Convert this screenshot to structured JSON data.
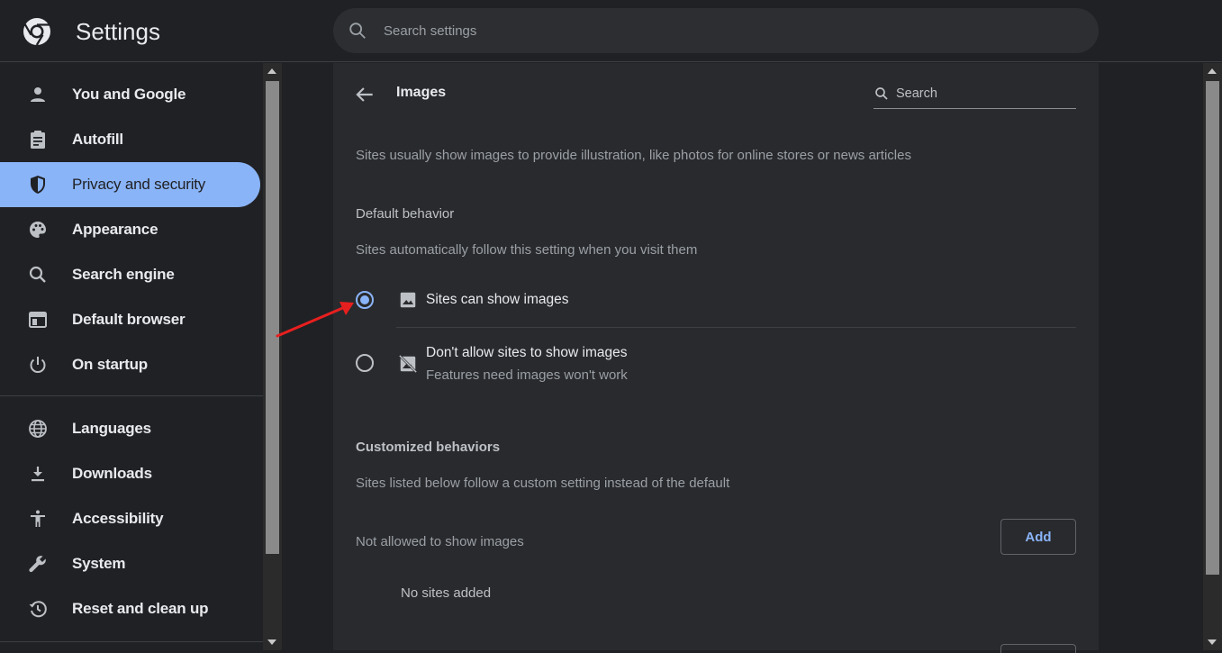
{
  "app": {
    "title": "Settings"
  },
  "search": {
    "placeholder": "Search settings"
  },
  "sidebar": {
    "items": [
      {
        "label": "You and Google",
        "icon": "person-icon"
      },
      {
        "label": "Autofill",
        "icon": "clipboard-icon"
      },
      {
        "label": "Privacy and security",
        "icon": "shield-icon",
        "active": true
      },
      {
        "label": "Appearance",
        "icon": "palette-icon"
      },
      {
        "label": "Search engine",
        "icon": "search-icon"
      },
      {
        "label": "Default browser",
        "icon": "browser-window-icon"
      },
      {
        "label": "On startup",
        "icon": "power-icon"
      },
      {
        "label": "Languages",
        "icon": "globe-icon"
      },
      {
        "label": "Downloads",
        "icon": "download-icon"
      },
      {
        "label": "Accessibility",
        "icon": "accessibility-icon"
      },
      {
        "label": "System",
        "icon": "wrench-icon"
      },
      {
        "label": "Reset and clean up",
        "icon": "history-icon"
      }
    ]
  },
  "page": {
    "title": "Images",
    "search_placeholder": "Search",
    "description": "Sites usually show images to provide illustration, like photos for online stores or news articles",
    "default_behavior": {
      "heading": "Default behavior",
      "subheading": "Sites automatically follow this setting when you visit them",
      "options": [
        {
          "label": "Sites can show images",
          "sublabel": "",
          "selected": true,
          "icon": "image-icon"
        },
        {
          "label": "Don't allow sites to show images",
          "sublabel": "Features need images won't work",
          "selected": false,
          "icon": "image-off-icon"
        }
      ]
    },
    "customized": {
      "heading": "Customized behaviors",
      "subheading": "Sites listed below follow a custom setting instead of the default",
      "not_allowed_label": "Not allowed to show images",
      "add_label": "Add",
      "empty_label": "No sites added"
    }
  },
  "colors": {
    "accent": "#8ab4f8",
    "annotation": "#e81f1f"
  }
}
